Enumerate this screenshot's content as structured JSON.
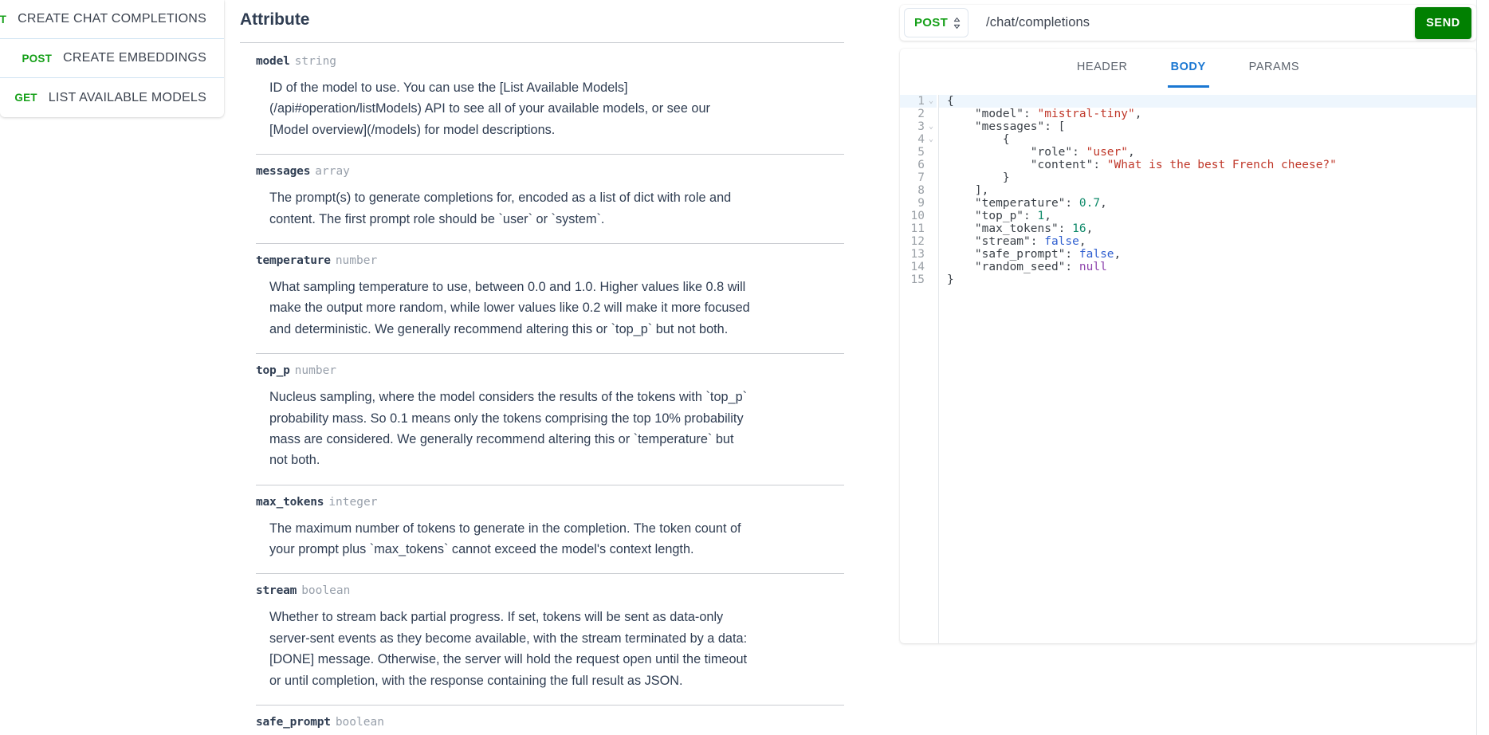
{
  "sidebar": {
    "items": [
      {
        "method": "POST",
        "label": "CREATE CHAT COMPLETIONS"
      },
      {
        "method": "POST",
        "label": "CREATE EMBEDDINGS"
      },
      {
        "method": "GET",
        "label": "LIST AVAILABLE MODELS"
      }
    ]
  },
  "attribute_panel": {
    "title": "Attribute",
    "attributes": [
      {
        "name": "model",
        "type": "string",
        "description": "ID of the model to use. You can use the [List Available Models](/api#operation/listModels) API to see all of your available models, or see our [Model overview](/models) for model descriptions."
      },
      {
        "name": "messages",
        "type": "array",
        "description": "The prompt(s) to generate completions for, encoded as a list of dict with role and content. The first prompt role should be `user` or `system`."
      },
      {
        "name": "temperature",
        "type": "number",
        "description": "What sampling temperature to use, between 0.0 and 1.0. Higher values like 0.8 will make the output more random, while lower values like 0.2 will make it more focused and deterministic. We generally recommend altering this or `top_p` but not both."
      },
      {
        "name": "top_p",
        "type": "number",
        "description": "Nucleus sampling, where the model considers the results of the tokens with `top_p` probability mass. So 0.1 means only the tokens comprising the top 10% probability mass are considered. We generally recommend altering this or `temperature` but not both."
      },
      {
        "name": "max_tokens",
        "type": "integer",
        "description": "The maximum number of tokens to generate in the completion. The token count of your prompt plus `max_tokens` cannot exceed the model's context length."
      },
      {
        "name": "stream",
        "type": "boolean",
        "description": "Whether to stream back partial progress. If set, tokens will be sent as data-only server-sent events as they become available, with the stream terminated by a data: [DONE] message. Otherwise, the server will hold the request open until the timeout or until completion, with the response containing the full result as JSON."
      },
      {
        "name": "safe_prompt",
        "type": "boolean",
        "description": ""
      }
    ]
  },
  "request_panel": {
    "method": "POST",
    "url": "/chat/completions",
    "send_label": "SEND",
    "tabs": [
      {
        "label": "HEADER",
        "active": false
      },
      {
        "label": "BODY",
        "active": true
      },
      {
        "label": "PARAMS",
        "active": false
      }
    ],
    "editor": {
      "active_line": 1,
      "fold_lines": [
        1,
        3,
        4
      ],
      "lines": [
        {
          "num": "1",
          "tokens": [
            {
              "t": "{",
              "c": "p"
            }
          ]
        },
        {
          "num": "2",
          "tokens": [
            {
              "t": "    \"model\": ",
              "c": "k"
            },
            {
              "t": "\"mistral-tiny\"",
              "c": "s"
            },
            {
              "t": ",",
              "c": "p"
            }
          ]
        },
        {
          "num": "3",
          "tokens": [
            {
              "t": "    \"messages\": [",
              "c": "k"
            }
          ]
        },
        {
          "num": "4",
          "tokens": [
            {
              "t": "        {",
              "c": "p"
            }
          ]
        },
        {
          "num": "5",
          "tokens": [
            {
              "t": "            \"role\": ",
              "c": "k"
            },
            {
              "t": "\"user\"",
              "c": "s"
            },
            {
              "t": ",",
              "c": "p"
            }
          ]
        },
        {
          "num": "6",
          "tokens": [
            {
              "t": "            \"content\": ",
              "c": "k"
            },
            {
              "t": "\"What is the best French cheese?\"",
              "c": "s"
            }
          ]
        },
        {
          "num": "7",
          "tokens": [
            {
              "t": "        }",
              "c": "p"
            }
          ]
        },
        {
          "num": "8",
          "tokens": [
            {
              "t": "    ],",
              "c": "p"
            }
          ]
        },
        {
          "num": "9",
          "tokens": [
            {
              "t": "    \"temperature\": ",
              "c": "k"
            },
            {
              "t": "0.7",
              "c": "n"
            },
            {
              "t": ",",
              "c": "p"
            }
          ]
        },
        {
          "num": "10",
          "tokens": [
            {
              "t": "    \"top_p\": ",
              "c": "k"
            },
            {
              "t": "1",
              "c": "n"
            },
            {
              "t": ",",
              "c": "p"
            }
          ]
        },
        {
          "num": "11",
          "tokens": [
            {
              "t": "    \"max_tokens\": ",
              "c": "k"
            },
            {
              "t": "16",
              "c": "n"
            },
            {
              "t": ",",
              "c": "p"
            }
          ]
        },
        {
          "num": "12",
          "tokens": [
            {
              "t": "    \"stream\": ",
              "c": "k"
            },
            {
              "t": "false",
              "c": "b"
            },
            {
              "t": ",",
              "c": "p"
            }
          ]
        },
        {
          "num": "13",
          "tokens": [
            {
              "t": "    \"safe_prompt\": ",
              "c": "k"
            },
            {
              "t": "false",
              "c": "b"
            },
            {
              "t": ",",
              "c": "p"
            }
          ]
        },
        {
          "num": "14",
          "tokens": [
            {
              "t": "    \"random_seed\": ",
              "c": "k"
            },
            {
              "t": "null",
              "c": "nu"
            }
          ]
        },
        {
          "num": "15",
          "tokens": [
            {
              "t": "}",
              "c": "p"
            }
          ]
        }
      ]
    }
  },
  "colors": {
    "method_green": "#16a019",
    "send_green": "#018001",
    "tab_active_blue": "#1a77d2",
    "text_dark": "#2f3d52",
    "type_gray": "#98a0ab",
    "string_red": "#c0392b",
    "number_teal": "#0f8a6a",
    "bool_blue": "#2f5fd0",
    "null_purple": "#8e44ad"
  }
}
